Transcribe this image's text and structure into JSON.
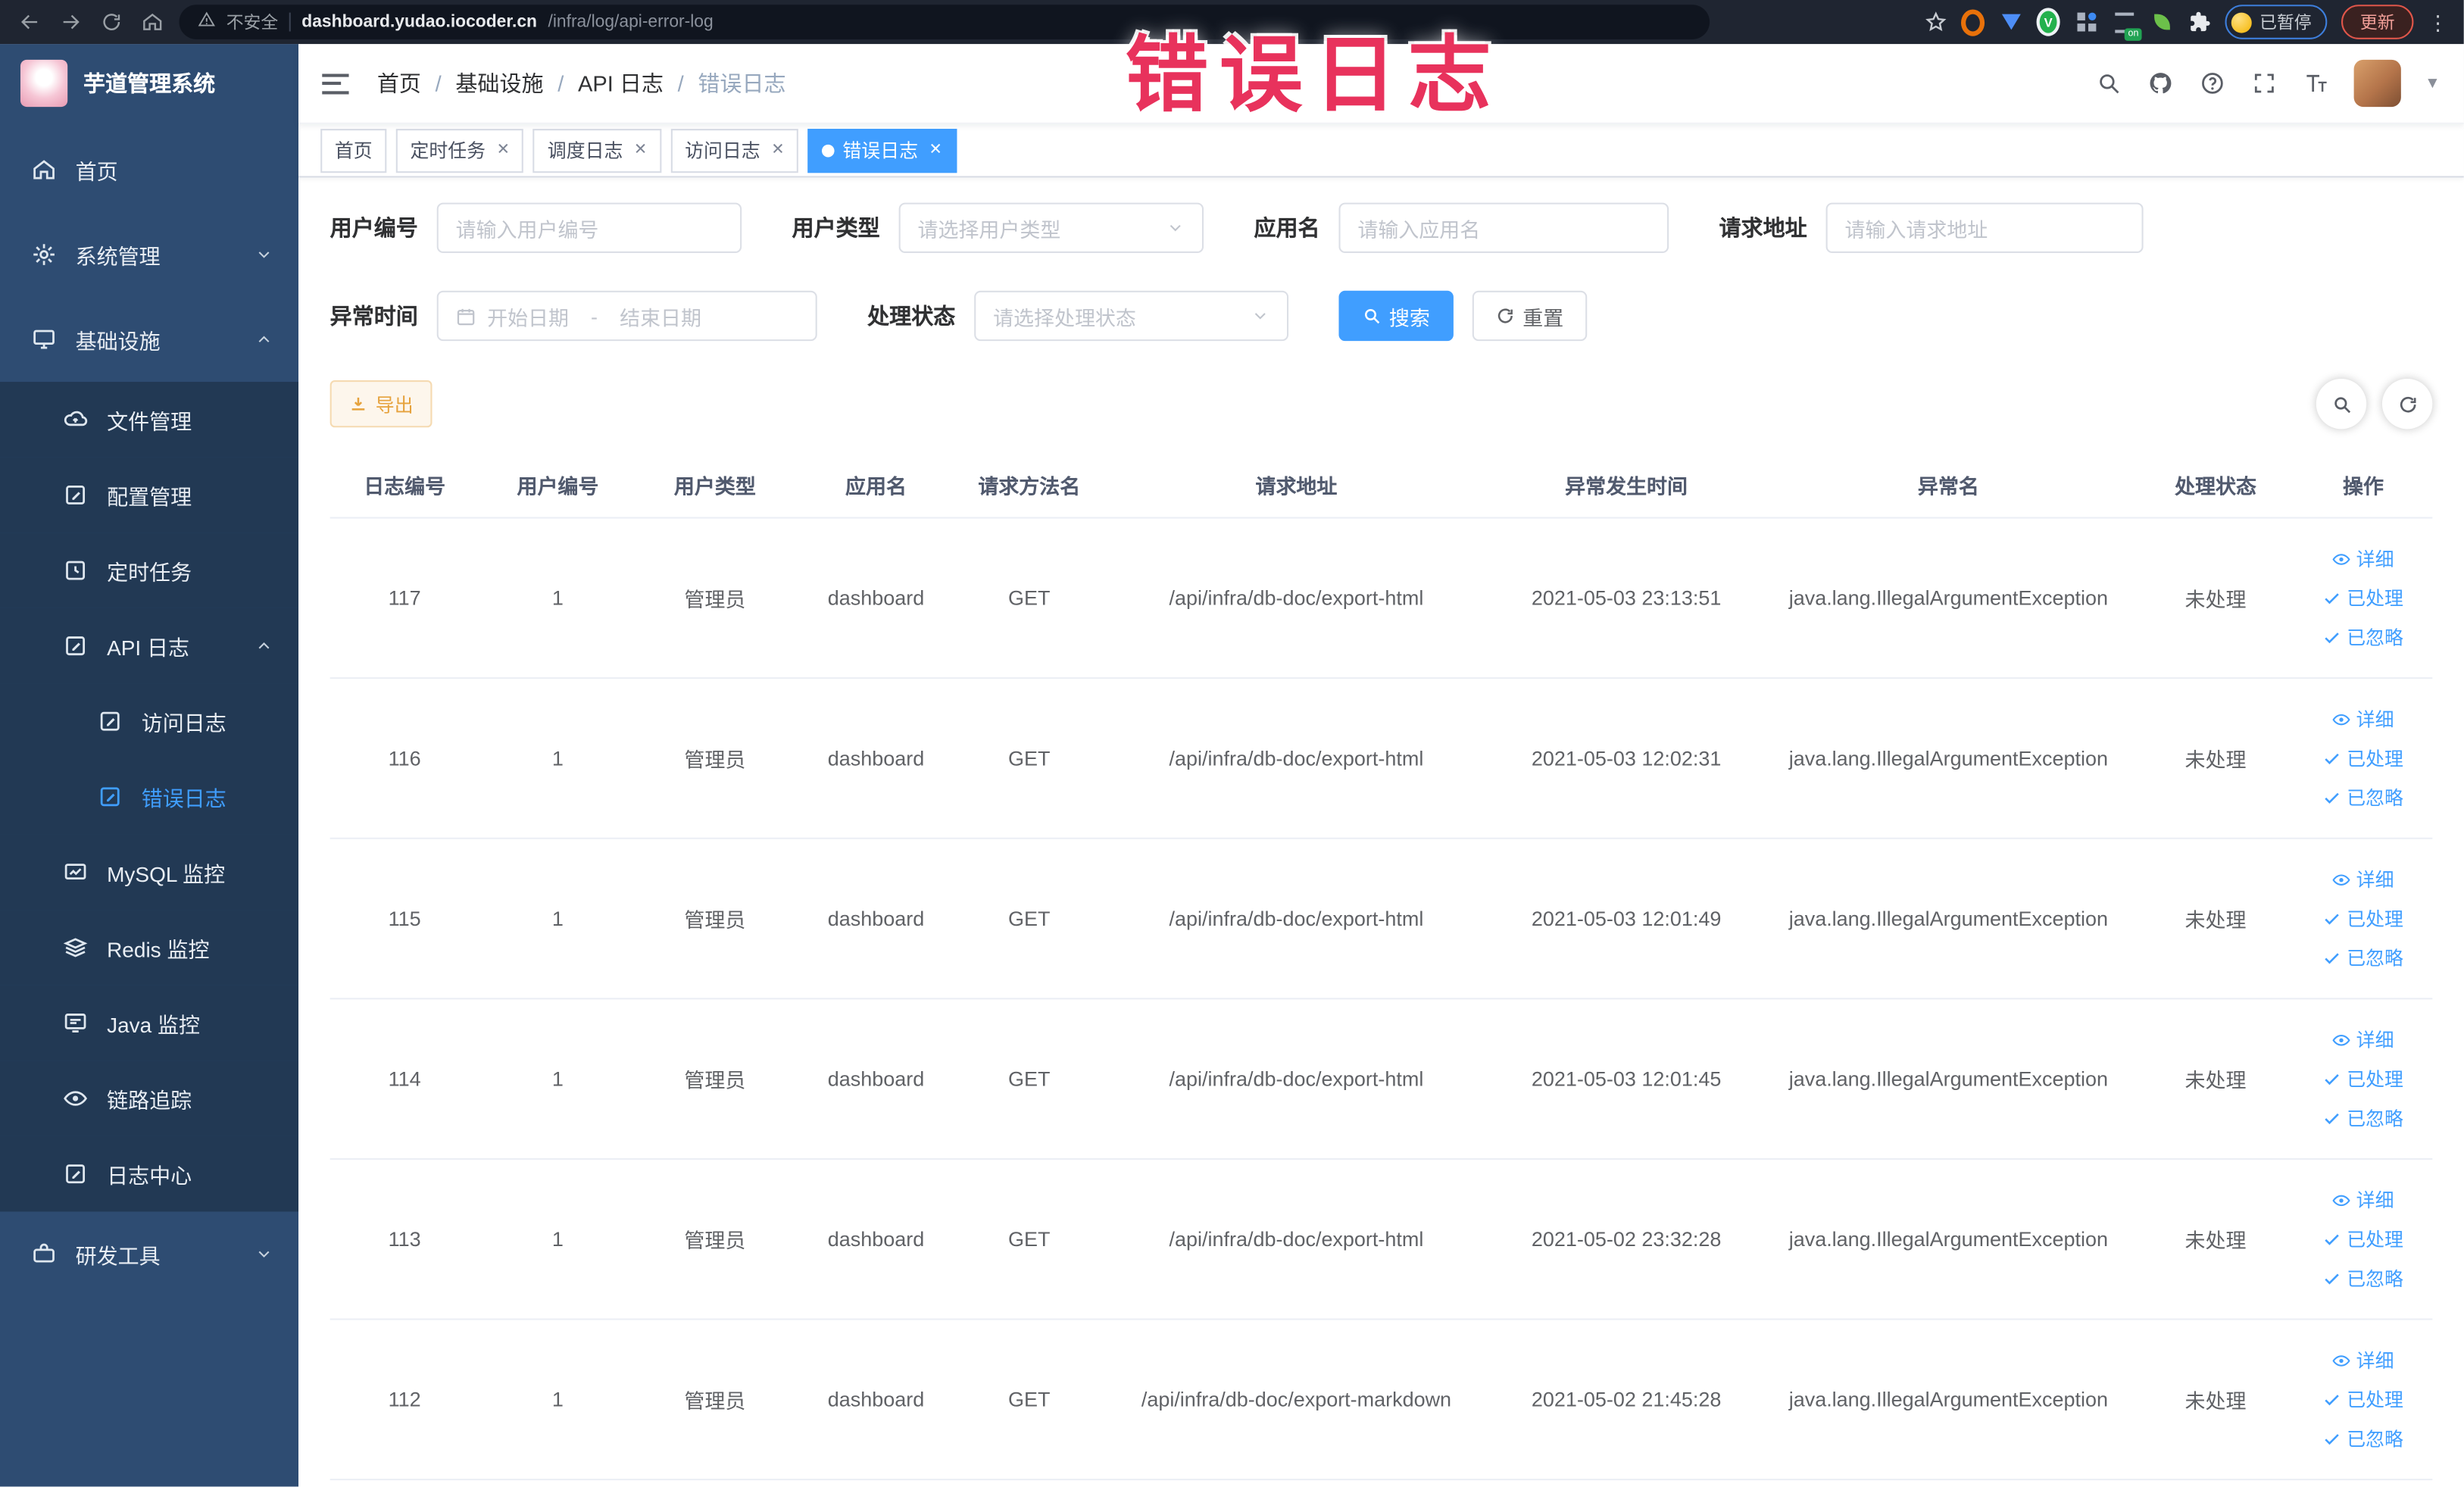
{
  "browser": {
    "security_label": "不安全",
    "url_host": "dashboard.yudao.iocoder.cn",
    "url_path": "/infra/log/api-error-log",
    "paused_label": "已暂停",
    "update_label": "更新",
    "extension_on_badge": "on",
    "kebab": "⋮"
  },
  "annotation": {
    "text": "错误日志",
    "color": "#e8325c"
  },
  "sidebar": {
    "title": "芋道管理系统",
    "menu": [
      {
        "key": "home",
        "label": "首页",
        "icon": "home-icon",
        "level": 1
      },
      {
        "key": "system",
        "label": "系统管理",
        "icon": "gear-icon",
        "level": 1,
        "arrow": "down"
      },
      {
        "key": "infra",
        "label": "基础设施",
        "icon": "monitor-icon",
        "level": 1,
        "arrow": "up"
      },
      {
        "key": "file",
        "label": "文件管理",
        "icon": "cloud-upload-icon",
        "level": 2,
        "sub": true
      },
      {
        "key": "config",
        "label": "配置管理",
        "icon": "edit-square-icon",
        "level": 2,
        "sub": true
      },
      {
        "key": "job",
        "label": "定时任务",
        "icon": "timer-icon",
        "level": 2,
        "sub": true
      },
      {
        "key": "api-log",
        "label": "API 日志",
        "icon": "edit-square-icon",
        "level": 2,
        "sub": true,
        "arrow": "up"
      },
      {
        "key": "access-log",
        "label": "访问日志",
        "icon": "edit-square-icon",
        "level": 3,
        "sub": true
      },
      {
        "key": "error-log",
        "label": "错误日志",
        "icon": "edit-square-icon",
        "level": 3,
        "sub": true,
        "active": true
      },
      {
        "key": "mysql",
        "label": "MySQL 监控",
        "icon": "chart-monitor-icon",
        "level": 2,
        "sub": true
      },
      {
        "key": "redis",
        "label": "Redis 监控",
        "icon": "layers-icon",
        "level": 2,
        "sub": true
      },
      {
        "key": "java",
        "label": "Java 监控",
        "icon": "screen-icon",
        "level": 2,
        "sub": true
      },
      {
        "key": "trace",
        "label": "链路追踪",
        "icon": "eye-icon",
        "level": 2,
        "sub": true
      },
      {
        "key": "log-center",
        "label": "日志中心",
        "icon": "edit-square-icon",
        "level": 2,
        "sub": true
      },
      {
        "key": "dev-tools",
        "label": "研发工具",
        "icon": "toolbox-icon",
        "level": 1,
        "arrow": "down"
      }
    ]
  },
  "breadcrumb": [
    "首页",
    "基础设施",
    "API 日志",
    "错误日志"
  ],
  "tabs": [
    {
      "key": "home",
      "label": "首页",
      "closable": false,
      "active": false
    },
    {
      "key": "job",
      "label": "定时任务",
      "closable": true,
      "active": false
    },
    {
      "key": "job-log",
      "label": "调度日志",
      "closable": true,
      "active": false
    },
    {
      "key": "access-log",
      "label": "访问日志",
      "closable": true,
      "active": false
    },
    {
      "key": "error-log",
      "label": "错误日志",
      "closable": true,
      "active": true
    }
  ],
  "filters": {
    "user_id": {
      "label": "用户编号",
      "placeholder": "请输入用户编号"
    },
    "user_type": {
      "label": "用户类型",
      "placeholder": "请选择用户类型"
    },
    "app_name": {
      "label": "应用名",
      "placeholder": "请输入应用名"
    },
    "request_url": {
      "label": "请求地址",
      "placeholder": "请输入请求地址"
    },
    "exception_time": {
      "label": "异常时间",
      "start_placeholder": "开始日期",
      "separator": "-",
      "end_placeholder": "结束日期"
    },
    "process_status": {
      "label": "处理状态",
      "placeholder": "请选择处理状态"
    },
    "search_label": "搜索",
    "reset_label": "重置"
  },
  "toolbar": {
    "export_label": "导出"
  },
  "table": {
    "columns": [
      "日志编号",
      "用户编号",
      "用户类型",
      "应用名",
      "请求方法名",
      "请求地址",
      "异常发生时间",
      "异常名",
      "处理状态",
      "操作"
    ],
    "actions": [
      {
        "key": "detail",
        "label": "详细",
        "icon": "eye-icon"
      },
      {
        "key": "process",
        "label": "已处理",
        "icon": "check-icon"
      },
      {
        "key": "ignore",
        "label": "已忽略",
        "icon": "check-icon"
      }
    ],
    "rows": [
      [
        "117",
        "1",
        "管理员",
        "dashboard",
        "GET",
        "/api/infra/db-doc/export-html",
        "2021-05-03 23:13:51",
        "java.lang.IllegalArgumentException",
        "未处理"
      ],
      [
        "116",
        "1",
        "管理员",
        "dashboard",
        "GET",
        "/api/infra/db-doc/export-html",
        "2021-05-03 12:02:31",
        "java.lang.IllegalArgumentException",
        "未处理"
      ],
      [
        "115",
        "1",
        "管理员",
        "dashboard",
        "GET",
        "/api/infra/db-doc/export-html",
        "2021-05-03 12:01:49",
        "java.lang.IllegalArgumentException",
        "未处理"
      ],
      [
        "114",
        "1",
        "管理员",
        "dashboard",
        "GET",
        "/api/infra/db-doc/export-html",
        "2021-05-03 12:01:45",
        "java.lang.IllegalArgumentException",
        "未处理"
      ],
      [
        "113",
        "1",
        "管理员",
        "dashboard",
        "GET",
        "/api/infra/db-doc/export-html",
        "2021-05-02 23:32:28",
        "java.lang.IllegalArgumentException",
        "未处理"
      ],
      [
        "112",
        "1",
        "管理员",
        "dashboard",
        "GET",
        "/api/infra/db-doc/export-markdown",
        "2021-05-02 21:45:28",
        "java.lang.IllegalArgumentException",
        "未处理"
      ]
    ]
  }
}
